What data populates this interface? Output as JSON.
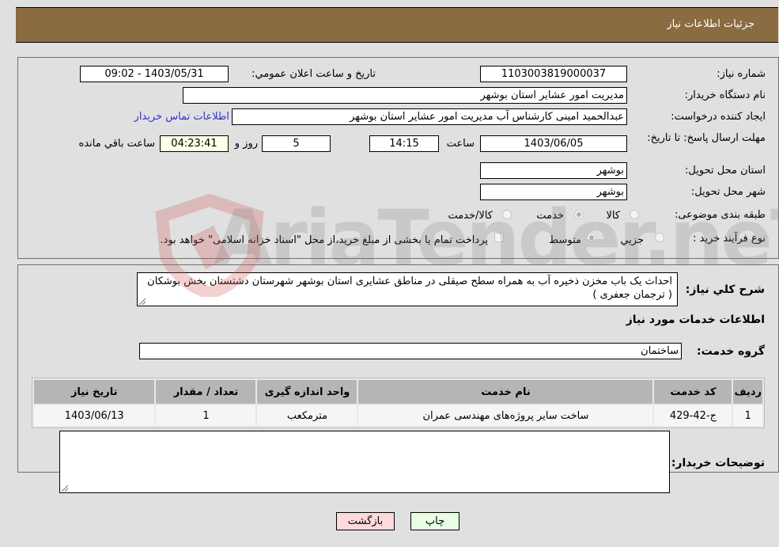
{
  "header": {
    "title": "جزئیات اطلاعات نیاز"
  },
  "form": {
    "need_number": {
      "label": "شماره نیاز:",
      "value": "1103003819000037"
    },
    "announce_datetime": {
      "label": "تاریخ و ساعت اعلان عمومي:",
      "value": "1403/05/31 - 09:02"
    },
    "buyer_org": {
      "label": "نام دستگاه خریدار:",
      "value": "مدیریت امور عشایر استان بوشهر"
    },
    "requester": {
      "label": "ایجاد کننده درخواست:",
      "value": "عبدالحمید امینی کارشناس آب مدیریت امور عشایر استان بوشهر"
    },
    "buyer_contact_link": "اطلاعات تماس خریدار",
    "deadline": {
      "label": "مهلت ارسال پاسخ: تا تاریخ:",
      "date": "1403/06/05",
      "time_label": "ساعت",
      "time": "14:15",
      "days": "5",
      "days_label": "روز و",
      "remaining": "04:23:41",
      "remaining_label": "ساعت باقي مانده"
    },
    "delivery_province": {
      "label": "استان محل تحویل:",
      "value": "بوشهر"
    },
    "delivery_city": {
      "label": "شهر محل تحویل:",
      "value": "بوشهر"
    },
    "category": {
      "label": "طبقه بندی موضوعی:",
      "options": [
        "کالا",
        "خدمت",
        "کالا/خدمت"
      ],
      "selected": "خدمت"
    },
    "purchase_process": {
      "label": "نوع فرآیند خرید :",
      "options": [
        "جزيي",
        "متوسط"
      ],
      "selected": "متوسط",
      "payment_note": "پرداخت تمام یا بخشی از مبلغ خرید،از محل \"اسناد خزانه اسلامی\" خواهد بود."
    }
  },
  "description": {
    "label": "شرح کلي نیاز:",
    "value": "احداث یک باب مخزن ذخیره آب به همراه سطح صیقلی در مناطق عشایری استان بوشهر شهرستان دشتستان  بخش بوشکان  ( ترجمان جعفری )"
  },
  "services": {
    "section_title": "اطلاعات خدمات مورد نیاز",
    "group_label": "گروه خدمت:",
    "group_value": "ساختمان",
    "table": {
      "headers": [
        "ردیف",
        "کد خدمت",
        "نام خدمت",
        "واحد اندازه گیری",
        "تعداد / مقدار",
        "تاریخ نیاز"
      ],
      "rows": [
        [
          "1",
          "ج-42-429",
          "ساخت سایر پروژه‌های مهندسی عمران",
          "مترمکعب",
          "1",
          "1403/06/13"
        ]
      ]
    }
  },
  "buyer_notes": {
    "label": "توضیحات خریدار:",
    "value": ""
  },
  "buttons": {
    "print": "چاپ",
    "back": "بازگشت"
  },
  "watermark": {
    "text": "AriaTender.neT"
  }
}
